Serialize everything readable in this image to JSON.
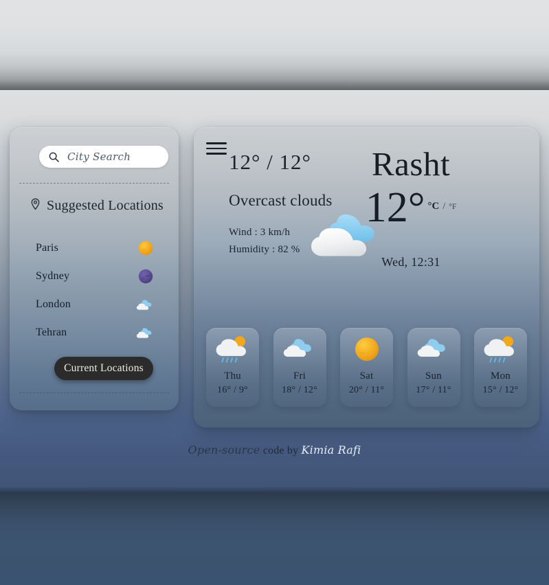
{
  "search": {
    "placeholder": "City Search",
    "value": "",
    "icon": "search-icon"
  },
  "sidebar": {
    "suggested_title": "Suggested Locations",
    "pin_icon": "map-pin-icon",
    "locations": [
      {
        "name": "Paris",
        "icon": "sun-icon",
        "icon_color": "#f2a81d"
      },
      {
        "name": "Sydney",
        "icon": "moon-icon",
        "icon_color": "#5b4e94"
      },
      {
        "name": "London",
        "icon": "cloud-icon",
        "icon_color": "#8ecdf0"
      },
      {
        "name": "Tehran",
        "icon": "cloud-icon",
        "icon_color": "#8ecdf0"
      }
    ],
    "current_button": "Current Locations"
  },
  "main": {
    "menu_icon": "hamburger-menu-icon",
    "high_low": "12° / 12°",
    "condition": "Overcast clouds",
    "wind": "Wind : 3 km/h",
    "humidity": "Humidity : 82 %",
    "condition_icon": "overcast-clouds-icon",
    "city": "Rasht",
    "temperature": "12°",
    "unit_celsius": "°C",
    "unit_separator": "/",
    "unit_fahrenheit": "°F",
    "active_unit": "°C",
    "datetime": "Wed, 12:31"
  },
  "forecast": [
    {
      "day": "Thu",
      "temps": "16° / 9°",
      "icon": "sun-rain-cloud-icon"
    },
    {
      "day": "Fri",
      "temps": "18° / 12°",
      "icon": "cloud-icon"
    },
    {
      "day": "Sat",
      "temps": "20° / 11°",
      "icon": "sun-icon"
    },
    {
      "day": "Sun",
      "temps": "17° / 11°",
      "icon": "cloud-icon"
    },
    {
      "day": "Mon",
      "temps": "15° / 12°",
      "icon": "sun-rain-cloud-icon"
    }
  ],
  "footer": {
    "open_source": "Open-source",
    "code_by": "code by",
    "author": "Kimia Rafi"
  },
  "colors": {
    "sun": "#f2a81d",
    "moon": "#5b4e94",
    "cloud_blue": "#8ecdf0",
    "cloud_white": "#f3f4f5",
    "button_dark": "#2b2b2b",
    "rain_blue": "#63b7e8"
  }
}
